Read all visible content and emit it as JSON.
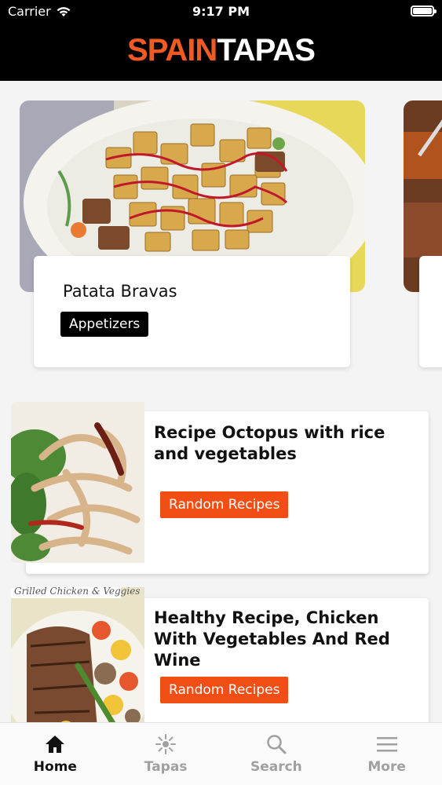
{
  "status_bar": {
    "carrier": "Carrier",
    "time": "9:17 PM"
  },
  "header": {
    "logo_part1": "SPAIN",
    "logo_part2": "TAPAS"
  },
  "featured": {
    "title": "Patata Bravas",
    "category": "Appetizers"
  },
  "recipes": [
    {
      "title": "Recipe Octopus with rice and vegetables",
      "tag": "Random Recipes"
    },
    {
      "title": "Healthy Recipe, Chicken With Vegetables And Red Wine",
      "tag": "Random Recipes"
    }
  ],
  "image_text": {
    "chicken_caption": "Grilled Chicken & Veggies"
  },
  "tabs": [
    {
      "label": "Home",
      "icon": "home-icon",
      "active": true
    },
    {
      "label": "Tapas",
      "icon": "sun-icon",
      "active": false
    },
    {
      "label": "Search",
      "icon": "search-icon",
      "active": false
    },
    {
      "label": "More",
      "icon": "menu-icon",
      "active": false
    }
  ],
  "colors": {
    "brand_orange": "#f15a22",
    "tag_orange": "#f04e14",
    "header_bg": "#000000"
  }
}
